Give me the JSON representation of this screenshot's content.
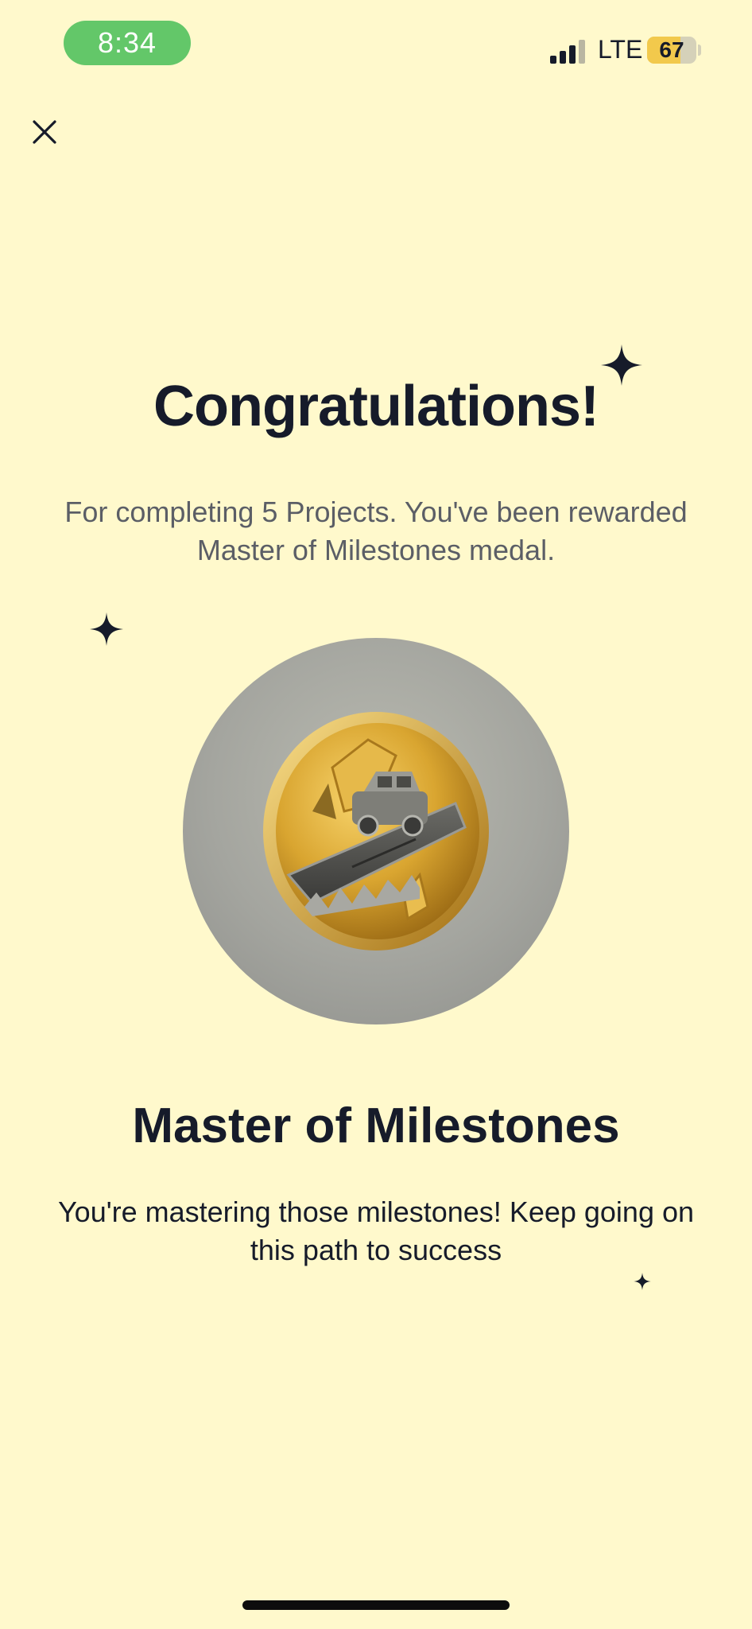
{
  "status_bar": {
    "time": "8:34",
    "network": "LTE",
    "battery_level": "67",
    "signal_bars_filled": 3,
    "signal_bars_total": 4
  },
  "header": {
    "close_icon": "close-icon"
  },
  "congrats": {
    "title": "Congratulations!",
    "message": "For completing 5 Projects. You've been rewarded Master of Milestones medal."
  },
  "medal": {
    "name": "Master of Milestones",
    "description": "You're mastering those milestones! Keep going on this path to success",
    "image_icon": "medal-icon"
  },
  "colors": {
    "background": "#fff9cc",
    "text_primary": "#161b2a",
    "text_secondary": "#5b5e66",
    "time_pill": "#63c769",
    "battery_fill": "#f2c94c",
    "medal_gold": "#d9a530"
  }
}
